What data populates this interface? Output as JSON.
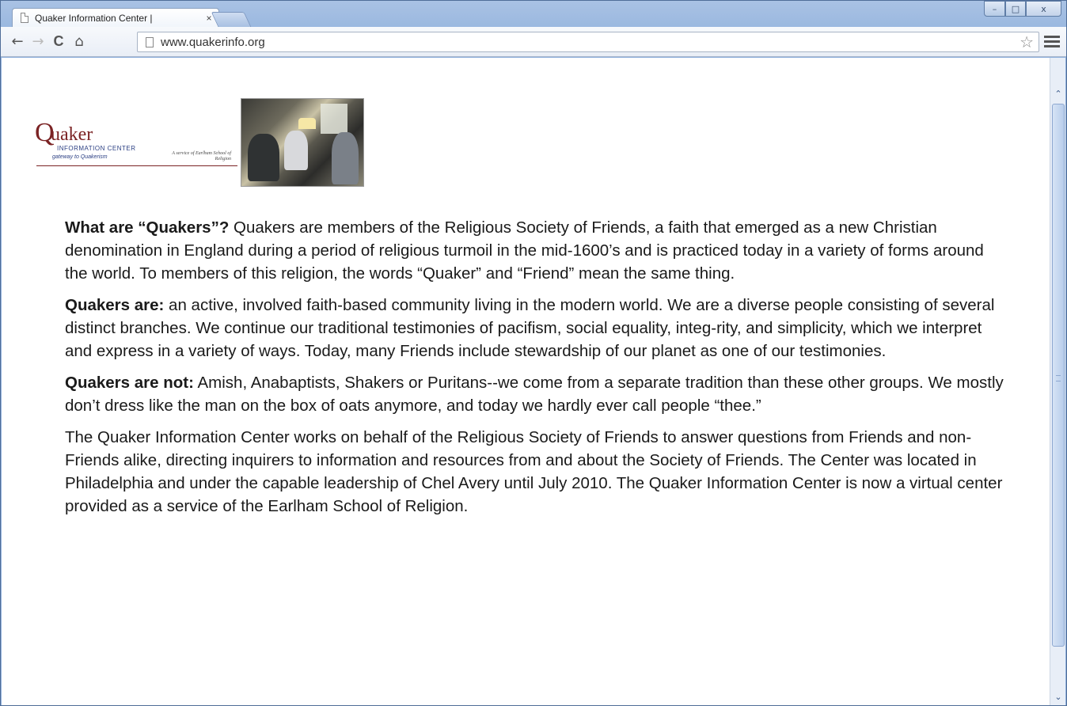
{
  "browser": {
    "tab_title": "Quaker Information Center |",
    "tab_close": "×",
    "url": "www.quakerinfo.org",
    "nav": {
      "back": "←",
      "forward": "→",
      "reload": "C",
      "home": "⌂"
    },
    "star": "☆",
    "window_controls": {
      "minimize": "–",
      "maximize": "□",
      "close": "x"
    },
    "scroll_up": "⌃",
    "scroll_down": "⌄"
  },
  "logo": {
    "initial": "Q",
    "name": "uaker",
    "center": "INFORMATION CENTER",
    "tagline": "gateway to Quakerism",
    "service": "A service of Earlham School of Religion"
  },
  "content": {
    "p1_lead": "What are “Quakers”?",
    "p1_text": " Quakers are members of the Religious Society of Friends, a faith that emerged as a new Christian denomination in England during a period of religious turmoil in the mid-1600’s and is practiced today in a variety of forms around the world. To members of this religion, the words “Quaker” and “Friend” mean the same thing.",
    "p2_lead": "Quakers are:",
    "p2_text": " an active, involved faith-based community living in the modern world. We are a diverse people consisting of several distinct branches. We continue our traditional testimonies of pacifism, social equality, integ-rity, and simplicity, which we interpret and express in a variety of ways. Today, many Friends include stewardship of our planet as one of our testimonies.",
    "p3_lead": "Quakers are not:",
    "p3_text": " Amish, Anabaptists, Shakers or Puritans--we come from a separate tradition than these other groups. We mostly don’t dress like the man on the box of oats anymore, and today we hardly ever call people “thee.”",
    "p4_text": "The Quaker Information Center works on behalf of the Religious Society of Friends to answer questions from Friends and non-Friends alike, directing inquirers to information and resources from and about the Society of Friends. The Center was located in Philadelphia and under the capable leadership of Chel Avery until July 2010. The Quaker Information Center is now a virtual center provided as a service of the Earlham School of Religion."
  }
}
